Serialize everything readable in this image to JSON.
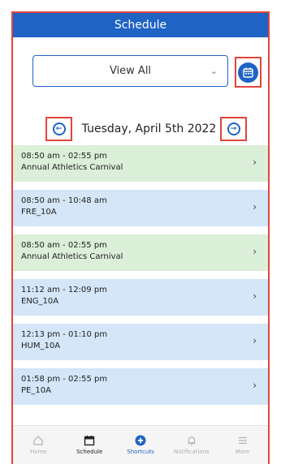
{
  "header": {
    "title": "Schedule"
  },
  "filter": {
    "selected": "View All"
  },
  "date_nav": {
    "label": "Tuesday, April 5th 2022"
  },
  "events": [
    {
      "time": "08:50 am - 02:55 pm",
      "title": "Annual Athletics Carnival",
      "color": "green"
    },
    {
      "time": "08:50 am - 10:48 am",
      "title": "FRE_10A",
      "color": "blue"
    },
    {
      "time": "08:50 am - 02:55 pm",
      "title": "Annual Athletics Carnival",
      "color": "green"
    },
    {
      "time": "11:12 am - 12:09 pm",
      "title": "ENG_10A",
      "color": "blue"
    },
    {
      "time": "12:13 pm - 01:10 pm",
      "title": "HUM_10A",
      "color": "blue"
    },
    {
      "time": "01:58 pm - 02:55 pm",
      "title": "PE_10A",
      "color": "blue"
    }
  ],
  "tabbar": {
    "home": "Home",
    "schedule": "Schedule",
    "shortcuts": "Shortcuts",
    "notifications": "Notifications",
    "more": "More"
  },
  "colors": {
    "brand": "#1f63c4",
    "green_card": "#dcefd9",
    "blue_card": "#d4e6f8",
    "highlight": "#e2453c"
  }
}
